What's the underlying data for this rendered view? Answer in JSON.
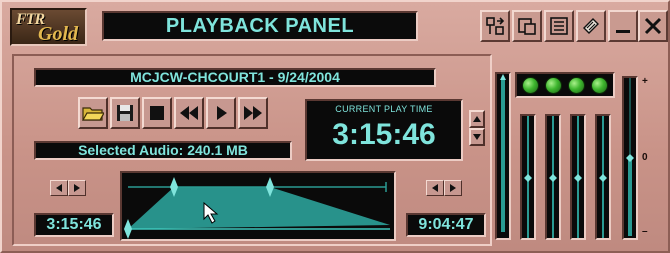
{
  "app": {
    "logo_text_top": "FTR",
    "logo_text_bottom": "Gold",
    "title": "PLAYBACK PANEL"
  },
  "titlebar_buttons": [
    {
      "icon": "split-icon"
    },
    {
      "icon": "restore-window-icon"
    },
    {
      "icon": "list-view-icon"
    },
    {
      "icon": "notes-icon"
    },
    {
      "icon": "minimize-icon"
    },
    {
      "icon": "close-icon"
    }
  ],
  "session": {
    "name": "MCJCW-CHCOURT1 - 9/24/2004"
  },
  "transport": {
    "buttons": [
      {
        "icon": "open-folder-icon"
      },
      {
        "icon": "save-disk-icon"
      },
      {
        "icon": "stop-icon"
      },
      {
        "icon": "rewind-icon"
      },
      {
        "icon": "play-icon"
      },
      {
        "icon": "fast-forward-icon"
      }
    ]
  },
  "play_time": {
    "label": "CURRENT PLAY TIME",
    "value": "3:15:46"
  },
  "selected_audio": "Selected Audio: 240.1 MB",
  "timeline": {
    "start_time": "3:15:46",
    "end_time": "9:04:47"
  },
  "meters": {
    "scale_top": "+",
    "scale_mid": "0",
    "scale_bottom": "–",
    "led_count": 4,
    "colors": {
      "led": "#3eb62e",
      "meter": "#2a9a92",
      "lcd_text": "#7fe4dc"
    }
  }
}
